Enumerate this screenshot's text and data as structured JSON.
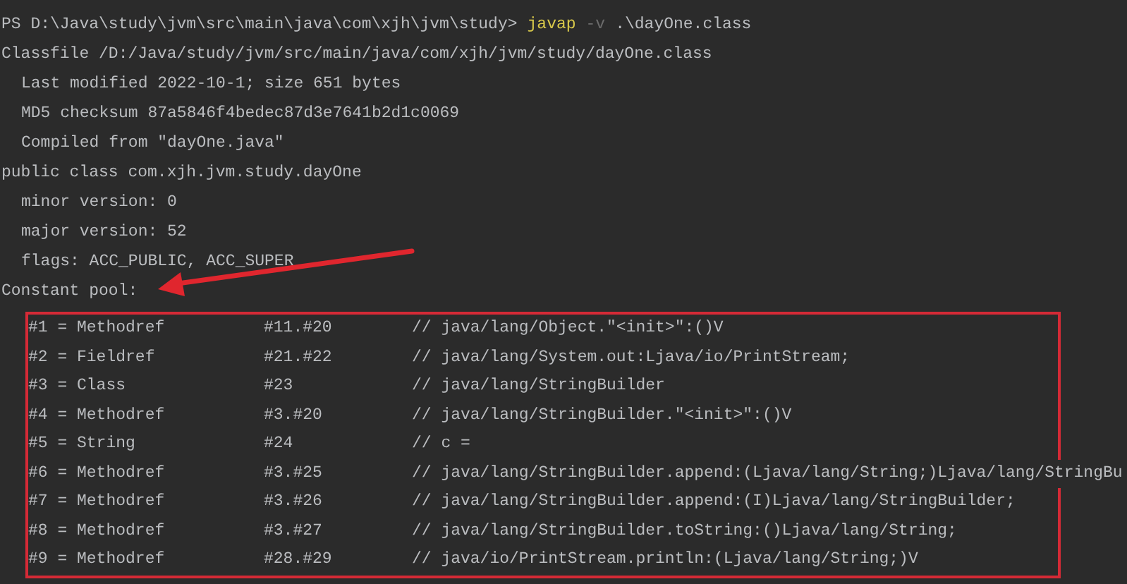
{
  "terminal": {
    "prompt": {
      "path": "PS D:\\Java\\study\\jvm\\src\\main\\java\\com\\xjh\\jvm\\study>",
      "command": "javap",
      "flag": "-v",
      "argument": ".\\dayOne.class"
    },
    "lines": [
      {
        "kind": "top",
        "text": "Classfile /D:/Java/study/jvm/src/main/java/com/xjh/jvm/study/dayOne.class"
      },
      {
        "kind": "indented",
        "text": "Last modified 2022-10-1; size 651 bytes"
      },
      {
        "kind": "indented",
        "text": "MD5 checksum 87a5846f4bedec87d3e7641b2d1c0069"
      },
      {
        "kind": "indented",
        "text": "Compiled from \"dayOne.java\""
      },
      {
        "kind": "top",
        "text": "public class com.xjh.jvm.study.dayOne"
      },
      {
        "kind": "indented",
        "text": "minor version: 0"
      },
      {
        "kind": "indented",
        "text": "major version: 52"
      },
      {
        "kind": "indented",
        "text": "flags: ACC_PUBLIC, ACC_SUPER"
      },
      {
        "kind": "top",
        "text": "Constant pool:"
      }
    ],
    "constant_pool": [
      {
        "entry": "#1 = Methodref",
        "ref": "#11.#20",
        "comment": "// java/lang/Object.\"<init>\":()V"
      },
      {
        "entry": "#2 = Fieldref",
        "ref": "#21.#22",
        "comment": "// java/lang/System.out:Ljava/io/PrintStream;"
      },
      {
        "entry": "#3 = Class",
        "ref": "#23",
        "comment": "// java/lang/StringBuilder"
      },
      {
        "entry": "#4 = Methodref",
        "ref": "#3.#20",
        "comment": "// java/lang/StringBuilder.\"<init>\":()V"
      },
      {
        "entry": "#5 = String",
        "ref": "#24",
        "comment": "// c ="
      },
      {
        "entry": "#6 = Methodref",
        "ref": "#3.#25",
        "comment": "// java/lang/StringBuilder.append:(Ljava/lang/String;)Ljava/lang/StringBu"
      },
      {
        "entry": "#7 = Methodref",
        "ref": "#3.#26",
        "comment": "// java/lang/StringBuilder.append:(I)Ljava/lang/StringBuilder;"
      },
      {
        "entry": "#8 = Methodref",
        "ref": "#3.#27",
        "comment": "// java/lang/StringBuilder.toString:()Ljava/lang/String;"
      },
      {
        "entry": "#9 = Methodref",
        "ref": "#28.#29",
        "comment": "// java/io/PrintStream.println:(Ljava/lang/String;)V"
      }
    ]
  }
}
